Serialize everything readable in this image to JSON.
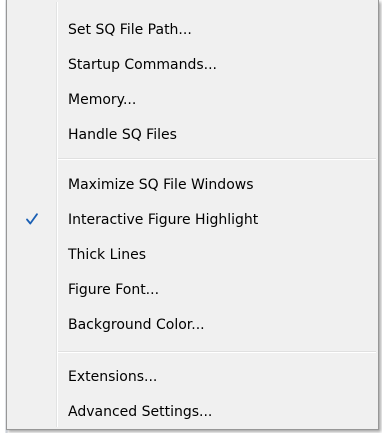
{
  "menu": {
    "groups": [
      {
        "items": [
          {
            "label": "Set SQ File Path...",
            "checked": false
          },
          {
            "label": "Startup Commands...",
            "checked": false
          },
          {
            "label": "Memory...",
            "checked": false
          },
          {
            "label": "Handle SQ Files",
            "checked": false
          }
        ]
      },
      {
        "items": [
          {
            "label": "Maximize SQ File Windows",
            "checked": false
          },
          {
            "label": "Interactive Figure Highlight",
            "checked": true
          },
          {
            "label": "Thick Lines",
            "checked": false
          },
          {
            "label": "Figure Font...",
            "checked": false
          },
          {
            "label": "Background Color...",
            "checked": false
          }
        ]
      },
      {
        "items": [
          {
            "label": "Extensions...",
            "checked": false
          },
          {
            "label": "Advanced Settings...",
            "checked": false
          }
        ]
      }
    ],
    "colors": {
      "background": "#f0f0f0",
      "border": "#979797",
      "checkmark": "#1a5fb4",
      "text": "#000000"
    },
    "icons": {
      "checkmark": "checkmark-icon"
    }
  }
}
